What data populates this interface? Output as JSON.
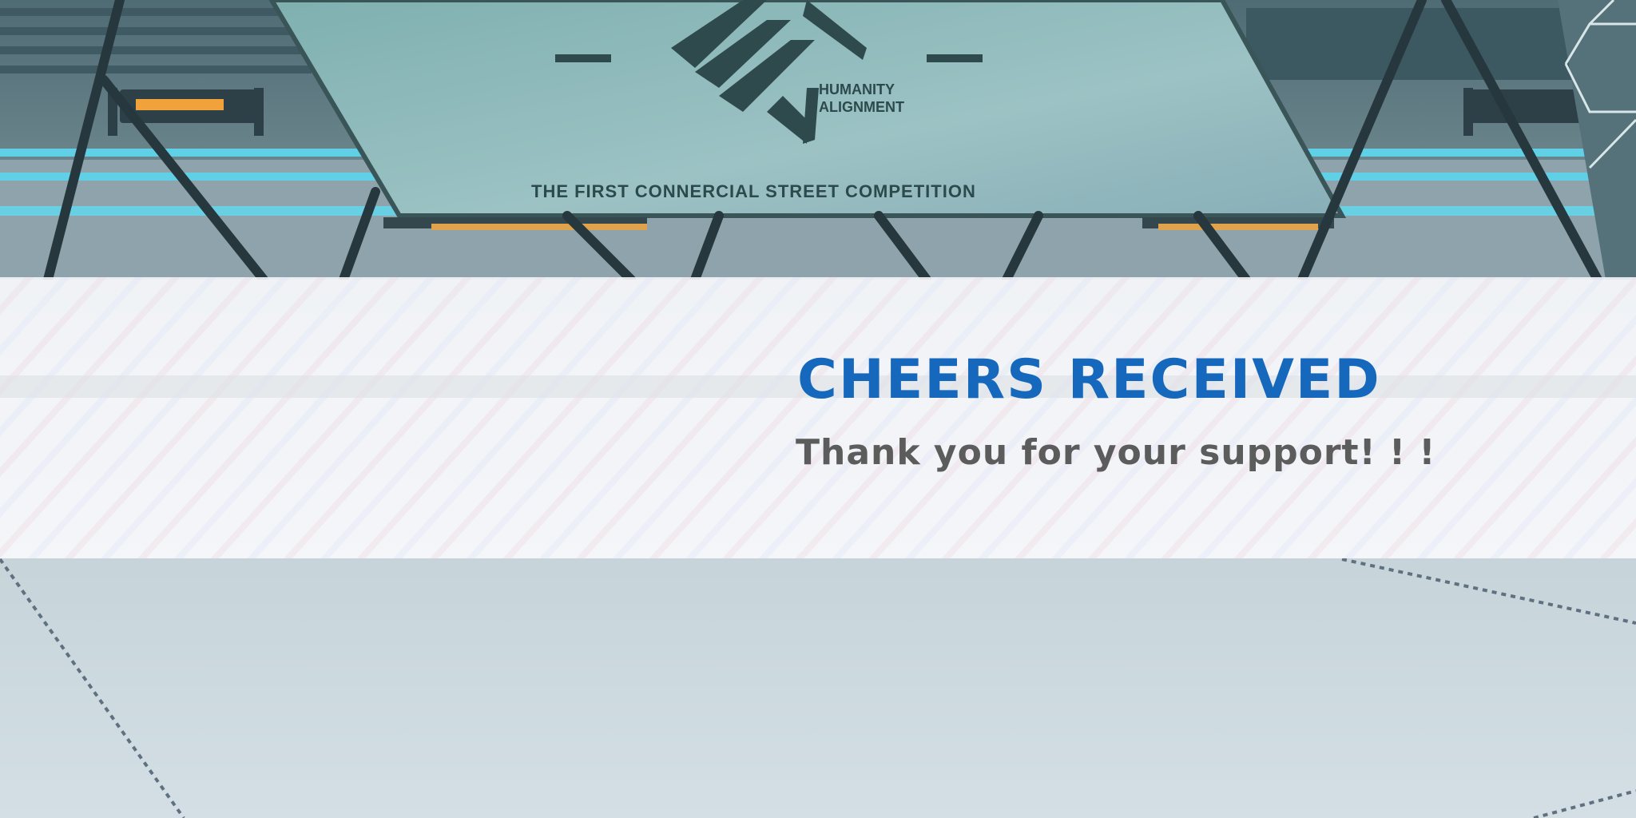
{
  "scene": {
    "sign_brand_line1": "HUMANITY",
    "sign_brand_line2": "ALIGNMENT",
    "sign_caption": "THE FIRST CONNERCIAL STREET COMPETITION"
  },
  "banner": {
    "title": "CHEERS RECEIVED",
    "subtitle": "Thank you for your support! ! !"
  },
  "colors": {
    "title": "#1668bd",
    "subtitle": "#5c5c5c",
    "banner_bg": "#f6f7fa",
    "sign_panel": "#8fb6b6",
    "floor": "#c9d6dc"
  }
}
